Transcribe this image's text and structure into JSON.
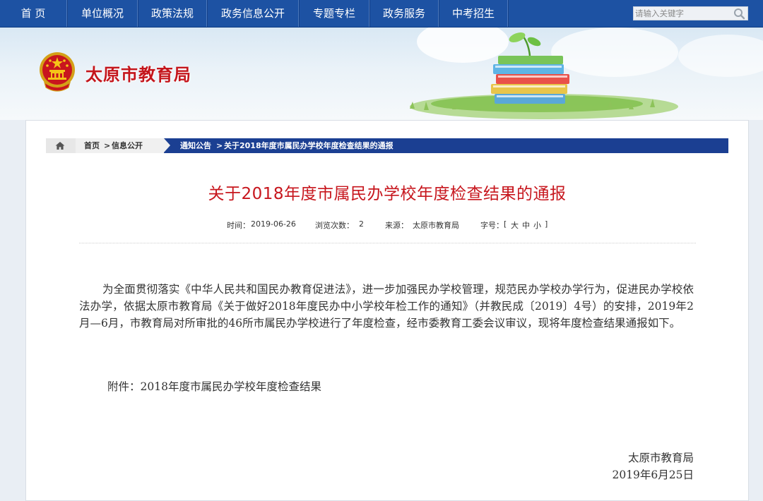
{
  "nav": {
    "items": [
      "首 页",
      "单位概况",
      "政策法规",
      "政务信息公开",
      "专题专栏",
      "政务服务",
      "中考招生"
    ],
    "search_placeholder": "请输入关键字"
  },
  "banner": {
    "site_title": "太原市教育局"
  },
  "breadcrumb": {
    "home": "首页",
    "sep1": ">",
    "info": "信息公开",
    "notice": "通知公告",
    "sep2": ">",
    "current": "关于2018年度市属民办学校年度检查结果的通报"
  },
  "article": {
    "title": "关于2018年度市属民办学校年度检查结果的通报",
    "meta": {
      "time_label": "时间：",
      "time": "2019-06-26",
      "views_label": "浏览次数：",
      "views": "2",
      "source_label": "来源：",
      "source": "太原市教育局",
      "font_label": "字号：",
      "font_open": "[",
      "font_large": "大",
      "font_medium": "中",
      "font_small": "小",
      "font_close": "]"
    },
    "body": "为全面贯彻落实《中华人民共和国民办教育促进法》，进一步加强民办学校管理，规范民办学校办学行为，促进民办学校依法办学，依据太原市教育局《关于做好2018年度民办中小学校年检工作的通知》（并教民成〔2019〕4号）的安排，2019年2月—6月，市教育局对所审批的46所市属民办学校进行了年度检查，经市委教育工委会议审议，现将年度检查结果通报如下。",
    "attachment": "附件：2018年度市属民办学校年度检查结果",
    "signature_org": "太原市教育局",
    "signature_date": "2019年6月25日"
  },
  "colors": {
    "nav_bg": "#1d52a3",
    "title_red": "#c7161d",
    "breadcrumb_bg": "#1b3f92"
  }
}
